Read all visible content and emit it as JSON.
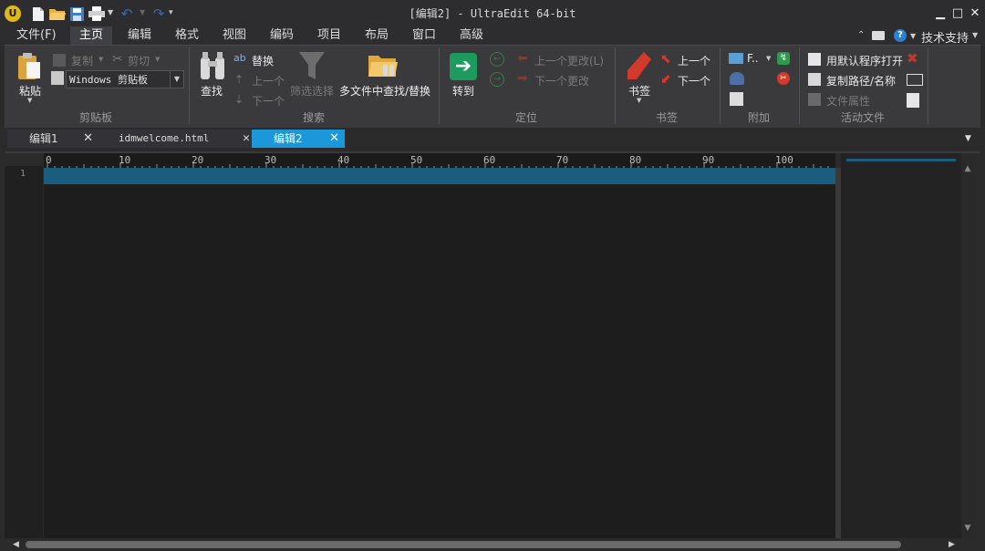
{
  "window": {
    "title": "[编辑2] - UltraEdit 64-bit",
    "minimize": "▁",
    "maximize": "□",
    "close": "✕"
  },
  "menu": [
    {
      "label": "文件(F)"
    },
    {
      "label": "主页"
    },
    {
      "label": "编辑"
    },
    {
      "label": "格式"
    },
    {
      "label": "视图"
    },
    {
      "label": "编码"
    },
    {
      "label": "项目"
    },
    {
      "label": "布局"
    },
    {
      "label": "窗口"
    },
    {
      "label": "高级"
    }
  ],
  "menu_right": {
    "help": "?",
    "support": "技术支持"
  },
  "ribbon": {
    "clipboard": {
      "paste": "粘贴",
      "copy": "复制",
      "cut": "剪切",
      "clipboard_select": "Windows 剪贴板",
      "group": "剪贴板"
    },
    "search": {
      "find": "查找",
      "replace": "替换",
      "prev": "上一个",
      "next": "下一个",
      "filter": "筛选选择",
      "multi": "多文件中查找/替换",
      "group": "搜索"
    },
    "goto": {
      "goto": "转到",
      "prev_change": "上一个更改(L)",
      "next_change": "下一个更改",
      "group": "定位"
    },
    "bookmarks": {
      "bookmark": "书签",
      "prev": "上一个",
      "next": "下一个",
      "group": "书签"
    },
    "addons": {
      "f_label": "F..",
      "group": "附加"
    },
    "activefile": {
      "open_default": "用默认程序打开",
      "copy_path": "复制路径/名称",
      "file_props": "文件属性",
      "group": "活动文件"
    }
  },
  "tabs": [
    {
      "label": "编辑1"
    },
    {
      "label": "idmwelcome.html"
    },
    {
      "label": "编辑2"
    }
  ],
  "ruler": [
    "0",
    "10",
    "20",
    "30",
    "40",
    "50",
    "60",
    "70",
    "80",
    "90",
    "100"
  ],
  "editor": {
    "line_numbers": [
      "1"
    ]
  }
}
